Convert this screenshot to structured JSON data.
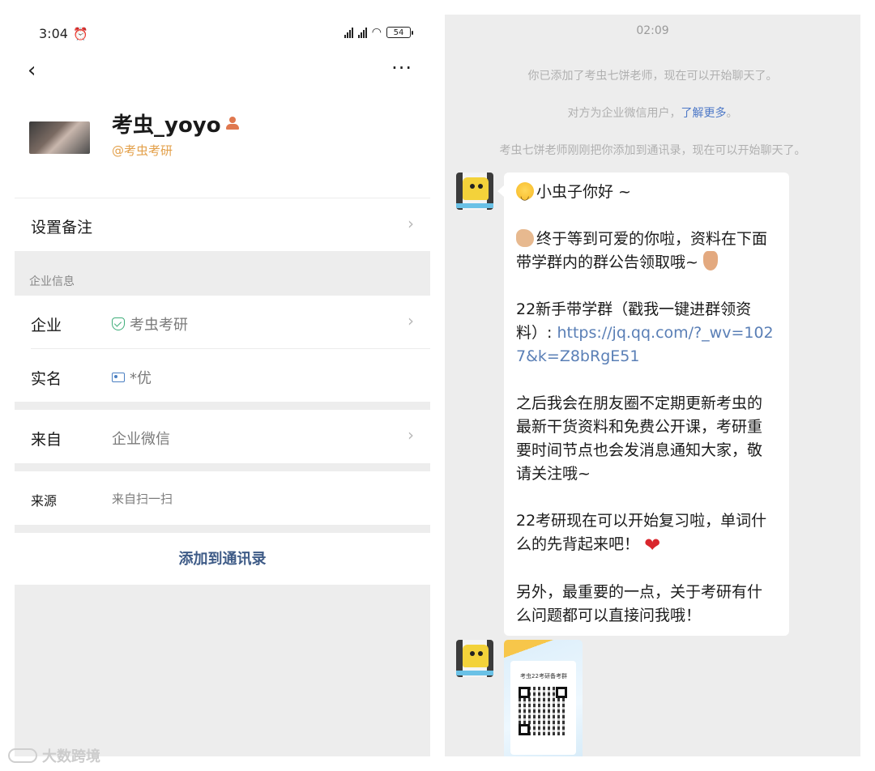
{
  "status_bar": {
    "time": "3:04",
    "battery": "54"
  },
  "profile": {
    "name": "考虫_yoyo",
    "company_tag": "@考虫考研"
  },
  "rows": {
    "remark_label": "设置备注",
    "section_title": "企业信息",
    "company_label": "企业",
    "company_value": "考虫考研",
    "realname_label": "实名",
    "realname_value": "*优",
    "from_label": "来自",
    "from_value": "企业微信",
    "source_label": "来源",
    "source_value": "来自扫一扫"
  },
  "add_button": "添加到通讯录",
  "chat": {
    "time": "02:09",
    "system_messages": [
      "你已添加了考虫七饼老师，现在可以开始聊天了。",
      "对方为企业微信用户，",
      "了解更多",
      "。",
      "考虫七饼老师刚刚把你添加到通讯录，现在可以开始聊天了。"
    ],
    "message": {
      "p1": "小虫子你好 ~",
      "p2": "终于等到可爱的你啦，资料在下面带学群内的群公告领取哦~",
      "p3_text": "22新手带学群（戳我一键进群领资料）: ",
      "p3_url": "https://jq.qq.com/?_wv=1027&k=Z8bRgE51",
      "p4": "之后我会在朋友圈不定期更新考虫的最新干货资料和免费公开课，考研重要时间节点也会发消息通知大家，敬请关注哦~",
      "p5": "22考研现在可以开始复习啦，单词什么的先背起来吧！",
      "p6": "另外，最重要的一点，关于考研有什么问题都可以直接问我哦！"
    },
    "poster_title": "考虫22考研备考群"
  },
  "watermark": "大数跨境"
}
